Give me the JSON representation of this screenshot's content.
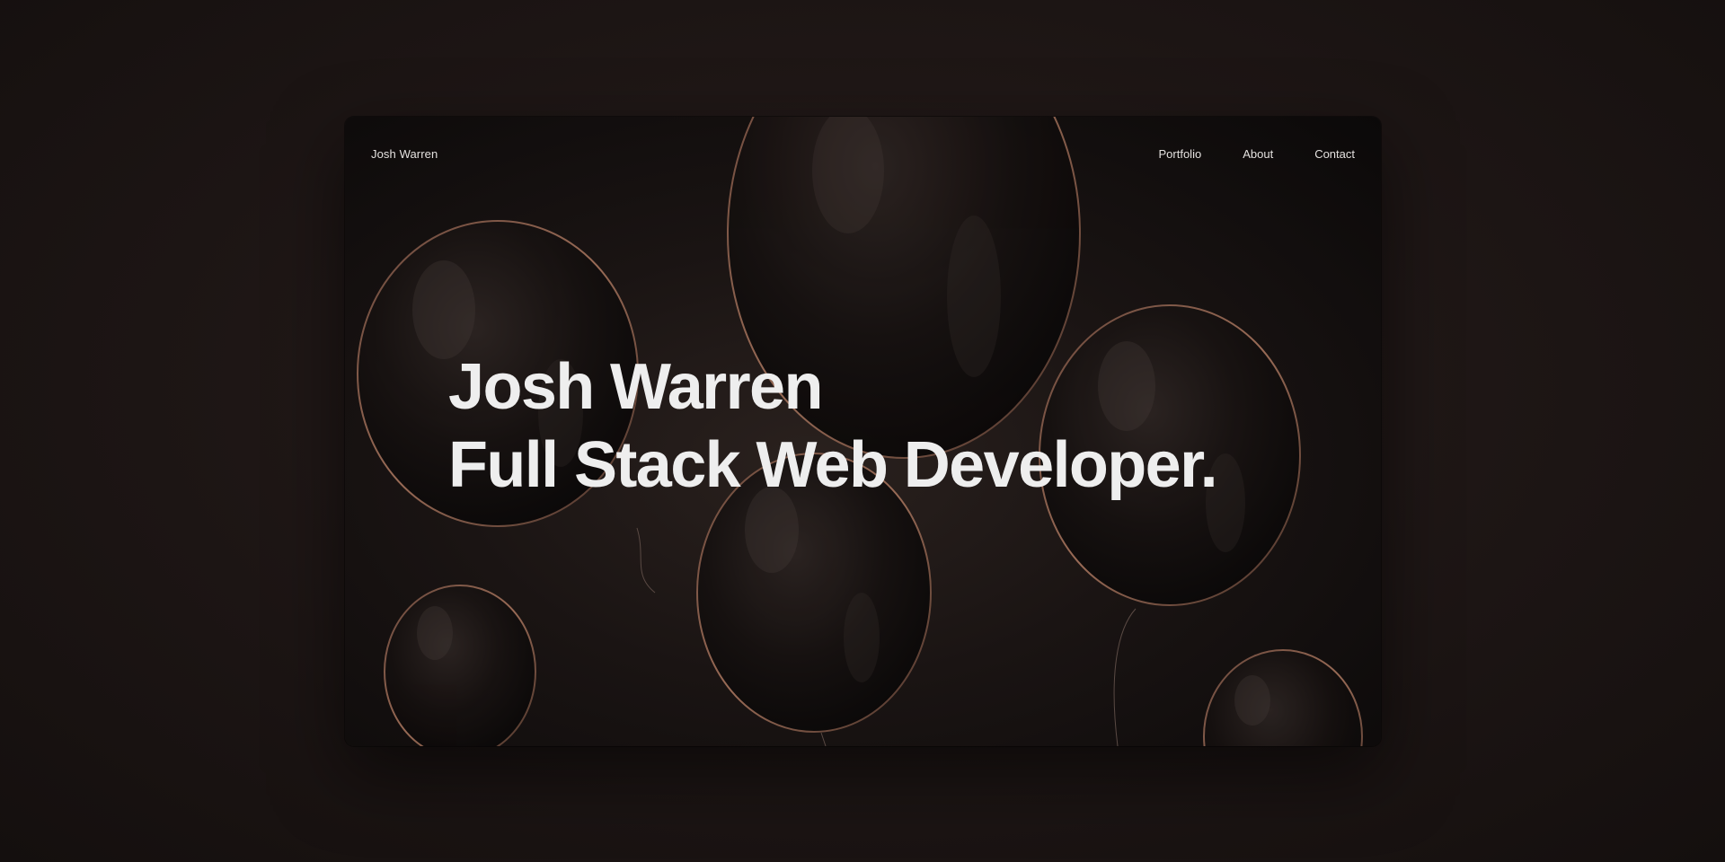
{
  "site": {
    "brand": "Josh Warren",
    "nav": [
      {
        "label": "Portfolio"
      },
      {
        "label": "About"
      },
      {
        "label": "Contact"
      }
    ]
  },
  "hero": {
    "line1": "Josh Warren",
    "line2": "Full Stack Web Developer."
  },
  "colors": {
    "page_background": "#1f1716",
    "frame_background": "#1a1413",
    "text": "#eeeeee",
    "balloon_rim": "#a0705a"
  },
  "background_image": "floating-dark-balloons"
}
